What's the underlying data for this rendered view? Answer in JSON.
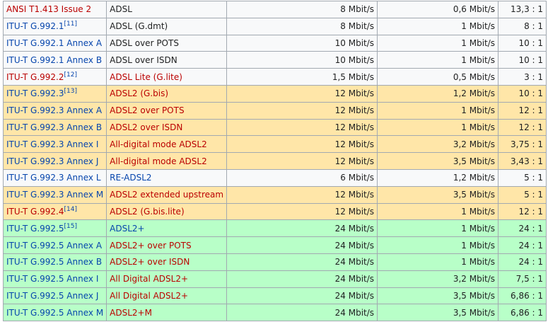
{
  "rows": [
    {
      "std": "ANSI T1.413 Issue 2",
      "ref": "",
      "std_color": "red",
      "name": "ADSL",
      "name_color": "plain",
      "down": "8 Mbit/s",
      "up": "0,6 Mbit/s",
      "ratio": "13,3 : 1",
      "bg": "w"
    },
    {
      "std": "ITU-T G.992.1",
      "ref": "[11]",
      "std_color": "blue",
      "name": "ADSL (G.dmt)",
      "name_color": "plain",
      "down": "8 Mbit/s",
      "up": "1 Mbit/s",
      "ratio": "8 : 1",
      "bg": "w"
    },
    {
      "std": "ITU-T G.992.1 Annex A",
      "ref": "",
      "std_color": "blue",
      "name": "ADSL over POTS",
      "name_color": "plain",
      "down": "10 Mbit/s",
      "up": "1 Mbit/s",
      "ratio": "10 : 1",
      "bg": "w"
    },
    {
      "std": "ITU-T G.992.1 Annex B",
      "ref": "",
      "std_color": "blue",
      "name": "ADSL over ISDN",
      "name_color": "plain",
      "down": "10 Mbit/s",
      "up": "1 Mbit/s",
      "ratio": "10 : 1",
      "bg": "w"
    },
    {
      "std": "ITU-T G.992.2",
      "ref": "[12]",
      "std_color": "red",
      "name": "ADSL Lite (G.lite)",
      "name_color": "red",
      "down": "1,5 Mbit/s",
      "up": "0,5 Mbit/s",
      "ratio": "3 : 1",
      "bg": "w"
    },
    {
      "std": "ITU-T G.992.3",
      "ref": "[13]",
      "std_color": "blue",
      "name": "ADSL2 (G.bis)",
      "name_color": "red",
      "down": "12 Mbit/s",
      "up": "1,2 Mbit/s",
      "ratio": "10 : 1",
      "bg": "y"
    },
    {
      "std": "ITU-T G.992.3 Annex A",
      "ref": "",
      "std_color": "blue",
      "name": "ADSL2 over POTS",
      "name_color": "red",
      "down": "12 Mbit/s",
      "up": "1 Mbit/s",
      "ratio": "12 : 1",
      "bg": "y"
    },
    {
      "std": "ITU-T G.992.3 Annex B",
      "ref": "",
      "std_color": "blue",
      "name": "ADSL2 over ISDN",
      "name_color": "red",
      "down": "12 Mbit/s",
      "up": "1 Mbit/s",
      "ratio": "12 : 1",
      "bg": "y"
    },
    {
      "std": "ITU-T G.992.3 Annex I",
      "ref": "",
      "std_color": "blue",
      "name": "All-digital mode ADSL2",
      "name_color": "red",
      "down": "12 Mbit/s",
      "up": "3,2 Mbit/s",
      "ratio": "3,75 : 1",
      "bg": "y"
    },
    {
      "std": "ITU-T G.992.3 Annex J",
      "ref": "",
      "std_color": "blue",
      "name": "All-digital mode ADSL2",
      "name_color": "red",
      "down": "12 Mbit/s",
      "up": "3,5 Mbit/s",
      "ratio": "3,43 : 1",
      "bg": "y"
    },
    {
      "std": "ITU-T G.992.3 Annex L",
      "ref": "",
      "std_color": "blue",
      "name": "RE-ADSL2",
      "name_color": "blue",
      "down": "6 Mbit/s",
      "up": "1,2 Mbit/s",
      "ratio": "5 : 1",
      "bg": "w"
    },
    {
      "std": "ITU-T G.992.3 Annex M",
      "ref": "",
      "std_color": "blue",
      "name": "ADSL2 extended upstream",
      "name_color": "red",
      "down": "12 Mbit/s",
      "up": "3,5 Mbit/s",
      "ratio": "5 : 1",
      "bg": "y"
    },
    {
      "std": "ITU-T G.992.4",
      "ref": "[14]",
      "std_color": "red",
      "name": "ADSL2 (G.bis.lite)",
      "name_color": "red",
      "down": "12 Mbit/s",
      "up": "1 Mbit/s",
      "ratio": "12 : 1",
      "bg": "y"
    },
    {
      "std": "ITU-T G.992.5",
      "ref": "[15]",
      "std_color": "blue",
      "name": "ADSL2+",
      "name_color": "blue",
      "down": "24 Mbit/s",
      "up": "1 Mbit/s",
      "ratio": "24 : 1",
      "bg": "g"
    },
    {
      "std": "ITU-T G.992.5 Annex A",
      "ref": "",
      "std_color": "blue",
      "name": "ADSL2+ over POTS",
      "name_color": "red",
      "down": "24 Mbit/s",
      "up": "1 Mbit/s",
      "ratio": "24 : 1",
      "bg": "g"
    },
    {
      "std": "ITU-T G.992.5 Annex B",
      "ref": "",
      "std_color": "blue",
      "name": "ADSL2+ over ISDN",
      "name_color": "red",
      "down": "24 Mbit/s",
      "up": "1 Mbit/s",
      "ratio": "24 : 1",
      "bg": "g"
    },
    {
      "std": "ITU-T G.992.5 Annex I",
      "ref": "",
      "std_color": "blue",
      "name": "All Digital ADSL2+",
      "name_color": "red",
      "down": "24 Mbit/s",
      "up": "3,2 Mbit/s",
      "ratio": "7,5 : 1",
      "bg": "g"
    },
    {
      "std": "ITU-T G.992.5 Annex J",
      "ref": "",
      "std_color": "blue",
      "name": "All Digital ADSL2+",
      "name_color": "red",
      "down": "24 Mbit/s",
      "up": "3,5 Mbit/s",
      "ratio": "6,86 : 1",
      "bg": "g"
    },
    {
      "std": "ITU-T G.992.5 Annex M",
      "ref": "",
      "std_color": "blue",
      "name": "ADSL2+M",
      "name_color": "red",
      "down": "24 Mbit/s",
      "up": "3,5 Mbit/s",
      "ratio": "6,86 : 1",
      "bg": "g"
    }
  ]
}
